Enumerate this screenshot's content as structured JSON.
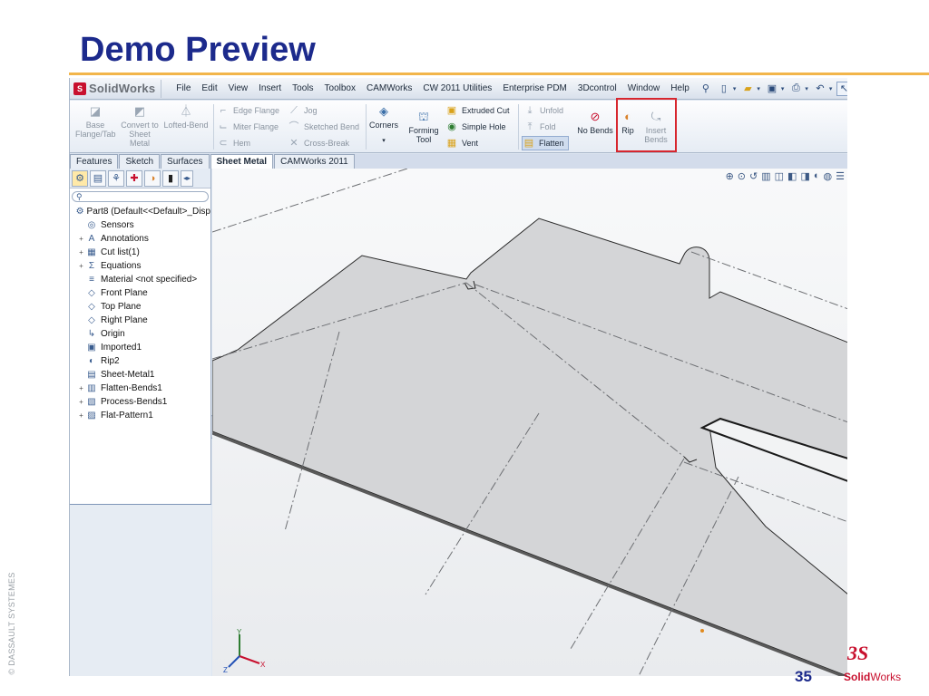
{
  "slide": {
    "title": "Demo Preview",
    "copyright": "© DASSAULT SYSTEMES",
    "page_number": "35",
    "logo": {
      "mark": "3S",
      "word_bold": "Solid",
      "word_rest": "Works"
    }
  },
  "app": {
    "brand": "SolidWorks",
    "menu": [
      "File",
      "Edit",
      "View",
      "Insert",
      "Tools",
      "Toolbox",
      "CAMWorks",
      "CW 2011 Utilities",
      "Enterprise PDM",
      "3Dcontrol",
      "Window",
      "Help"
    ],
    "ribbon": {
      "base_flange": "Base Flange/Tab",
      "convert": "Convert to Sheet Metal",
      "lofted_bend": "Lofted-Bend",
      "edge_flange": "Edge Flange",
      "miter_flange": "Miter Flange",
      "hem": "Hem",
      "jog": "Jog",
      "sketched_bend": "Sketched Bend",
      "cross_break": "Cross-Break",
      "corners": "Corners",
      "forming_tool": "Forming Tool",
      "extruded_cut": "Extruded Cut",
      "simple_hole": "Simple Hole",
      "vent": "Vent",
      "unfold": "Unfold",
      "fold": "Fold",
      "flatten": "Flatten",
      "no_bends": "No Bends",
      "rip": "Rip",
      "insert_bends": "Insert Bends"
    },
    "tabs": [
      "Features",
      "Sketch",
      "Surfaces",
      "Sheet Metal",
      "CAMWorks 2011"
    ],
    "active_tab": "Sheet Metal",
    "tree": [
      {
        "label": "Part8  (Default<<Default>_Disp",
        "icon": "part-icon",
        "expand": ""
      },
      {
        "label": "Sensors",
        "icon": "sensor-icon",
        "expand": ""
      },
      {
        "label": "Annotations",
        "icon": "annotation-icon",
        "expand": "+"
      },
      {
        "label": "Cut list(1)",
        "icon": "cutlist-icon",
        "expand": "+"
      },
      {
        "label": "Equations",
        "icon": "equation-icon",
        "expand": "+"
      },
      {
        "label": "Material <not specified>",
        "icon": "material-icon",
        "expand": ""
      },
      {
        "label": "Front Plane",
        "icon": "plane-icon",
        "expand": ""
      },
      {
        "label": "Top Plane",
        "icon": "plane-icon",
        "expand": ""
      },
      {
        "label": "Right Plane",
        "icon": "plane-icon",
        "expand": ""
      },
      {
        "label": "Origin",
        "icon": "origin-icon",
        "expand": ""
      },
      {
        "label": "Imported1",
        "icon": "imported-icon",
        "expand": ""
      },
      {
        "label": "Rip2",
        "icon": "rip-icon",
        "expand": ""
      },
      {
        "label": "Sheet-Metal1",
        "icon": "sheetmetal-icon",
        "expand": ""
      },
      {
        "label": "Flatten-Bends1",
        "icon": "flatten-icon",
        "expand": "+"
      },
      {
        "label": "Process-Bends1",
        "icon": "process-icon",
        "expand": "+"
      },
      {
        "label": "Flat-Pattern1",
        "icon": "flatpattern-icon",
        "expand": "+"
      }
    ],
    "triad": {
      "x": "X",
      "y": "Y",
      "z": "Z"
    },
    "colors": {
      "highlight": "#d7262e",
      "title": "#1c2a8c",
      "accent_rule": "#f2b54a"
    }
  }
}
